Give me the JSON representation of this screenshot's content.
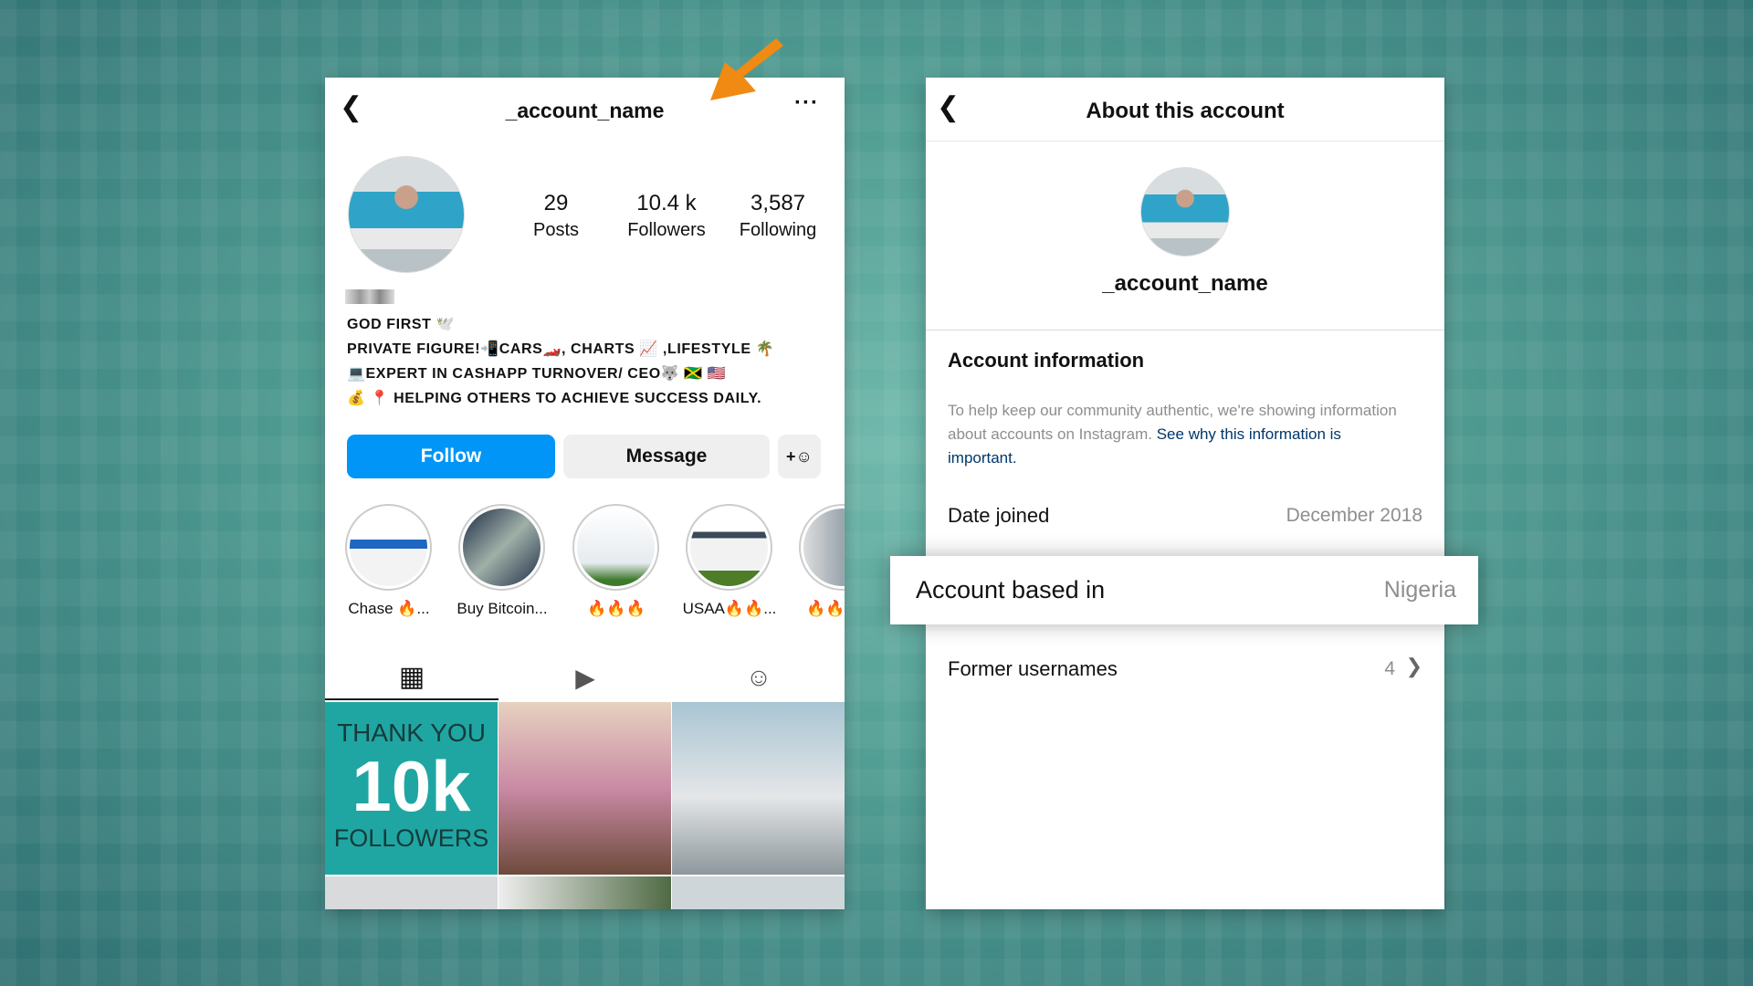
{
  "profile": {
    "username": "_account_name",
    "stats": [
      {
        "value": "29",
        "label": "Posts"
      },
      {
        "value": "10.4 k",
        "label": "Followers"
      },
      {
        "value": "3,587",
        "label": "Following"
      }
    ],
    "bio": [
      "GOD FIRST 🕊️",
      "PRIVATE FIGURE!📲CARS🏎️, CHARTS 📈 ,LIFESTYLE 🌴",
      "💻EXPERT IN CASHAPP TURNOVER/ CEO🐺 🇯🇲 🇺🇸",
      "💰 📍 HELPING OTHERS TO ACHIEVE SUCCESS DAILY."
    ],
    "follow_label": "Follow",
    "message_label": "Message",
    "follow_color": "#0095f6",
    "highlights": [
      {
        "label": "Chase 🔥..."
      },
      {
        "label": "Buy Bitcoin..."
      },
      {
        "label": "🔥🔥🔥"
      },
      {
        "label": "USAA🔥🔥..."
      },
      {
        "label": "🔥🔥"
      }
    ],
    "posts": [
      {
        "text_top": "THANK YOU",
        "text_big": "10k",
        "text_bottom": "FOLLOWERS"
      }
    ]
  },
  "about": {
    "title": "About this account",
    "username": "_account_name",
    "section_title": "Account information",
    "description": "To help keep our community authentic, we're showing information about accounts on Instagram.",
    "link": "See why this information is important.",
    "link_color": "#00376b",
    "rows": [
      {
        "label": "Date joined",
        "value": "December 2018"
      },
      {
        "label": "Account based in",
        "value": "Nigeria"
      },
      {
        "label": "Former usernames",
        "value": "4"
      }
    ]
  },
  "annotation_arrow_color": "#f08a12"
}
